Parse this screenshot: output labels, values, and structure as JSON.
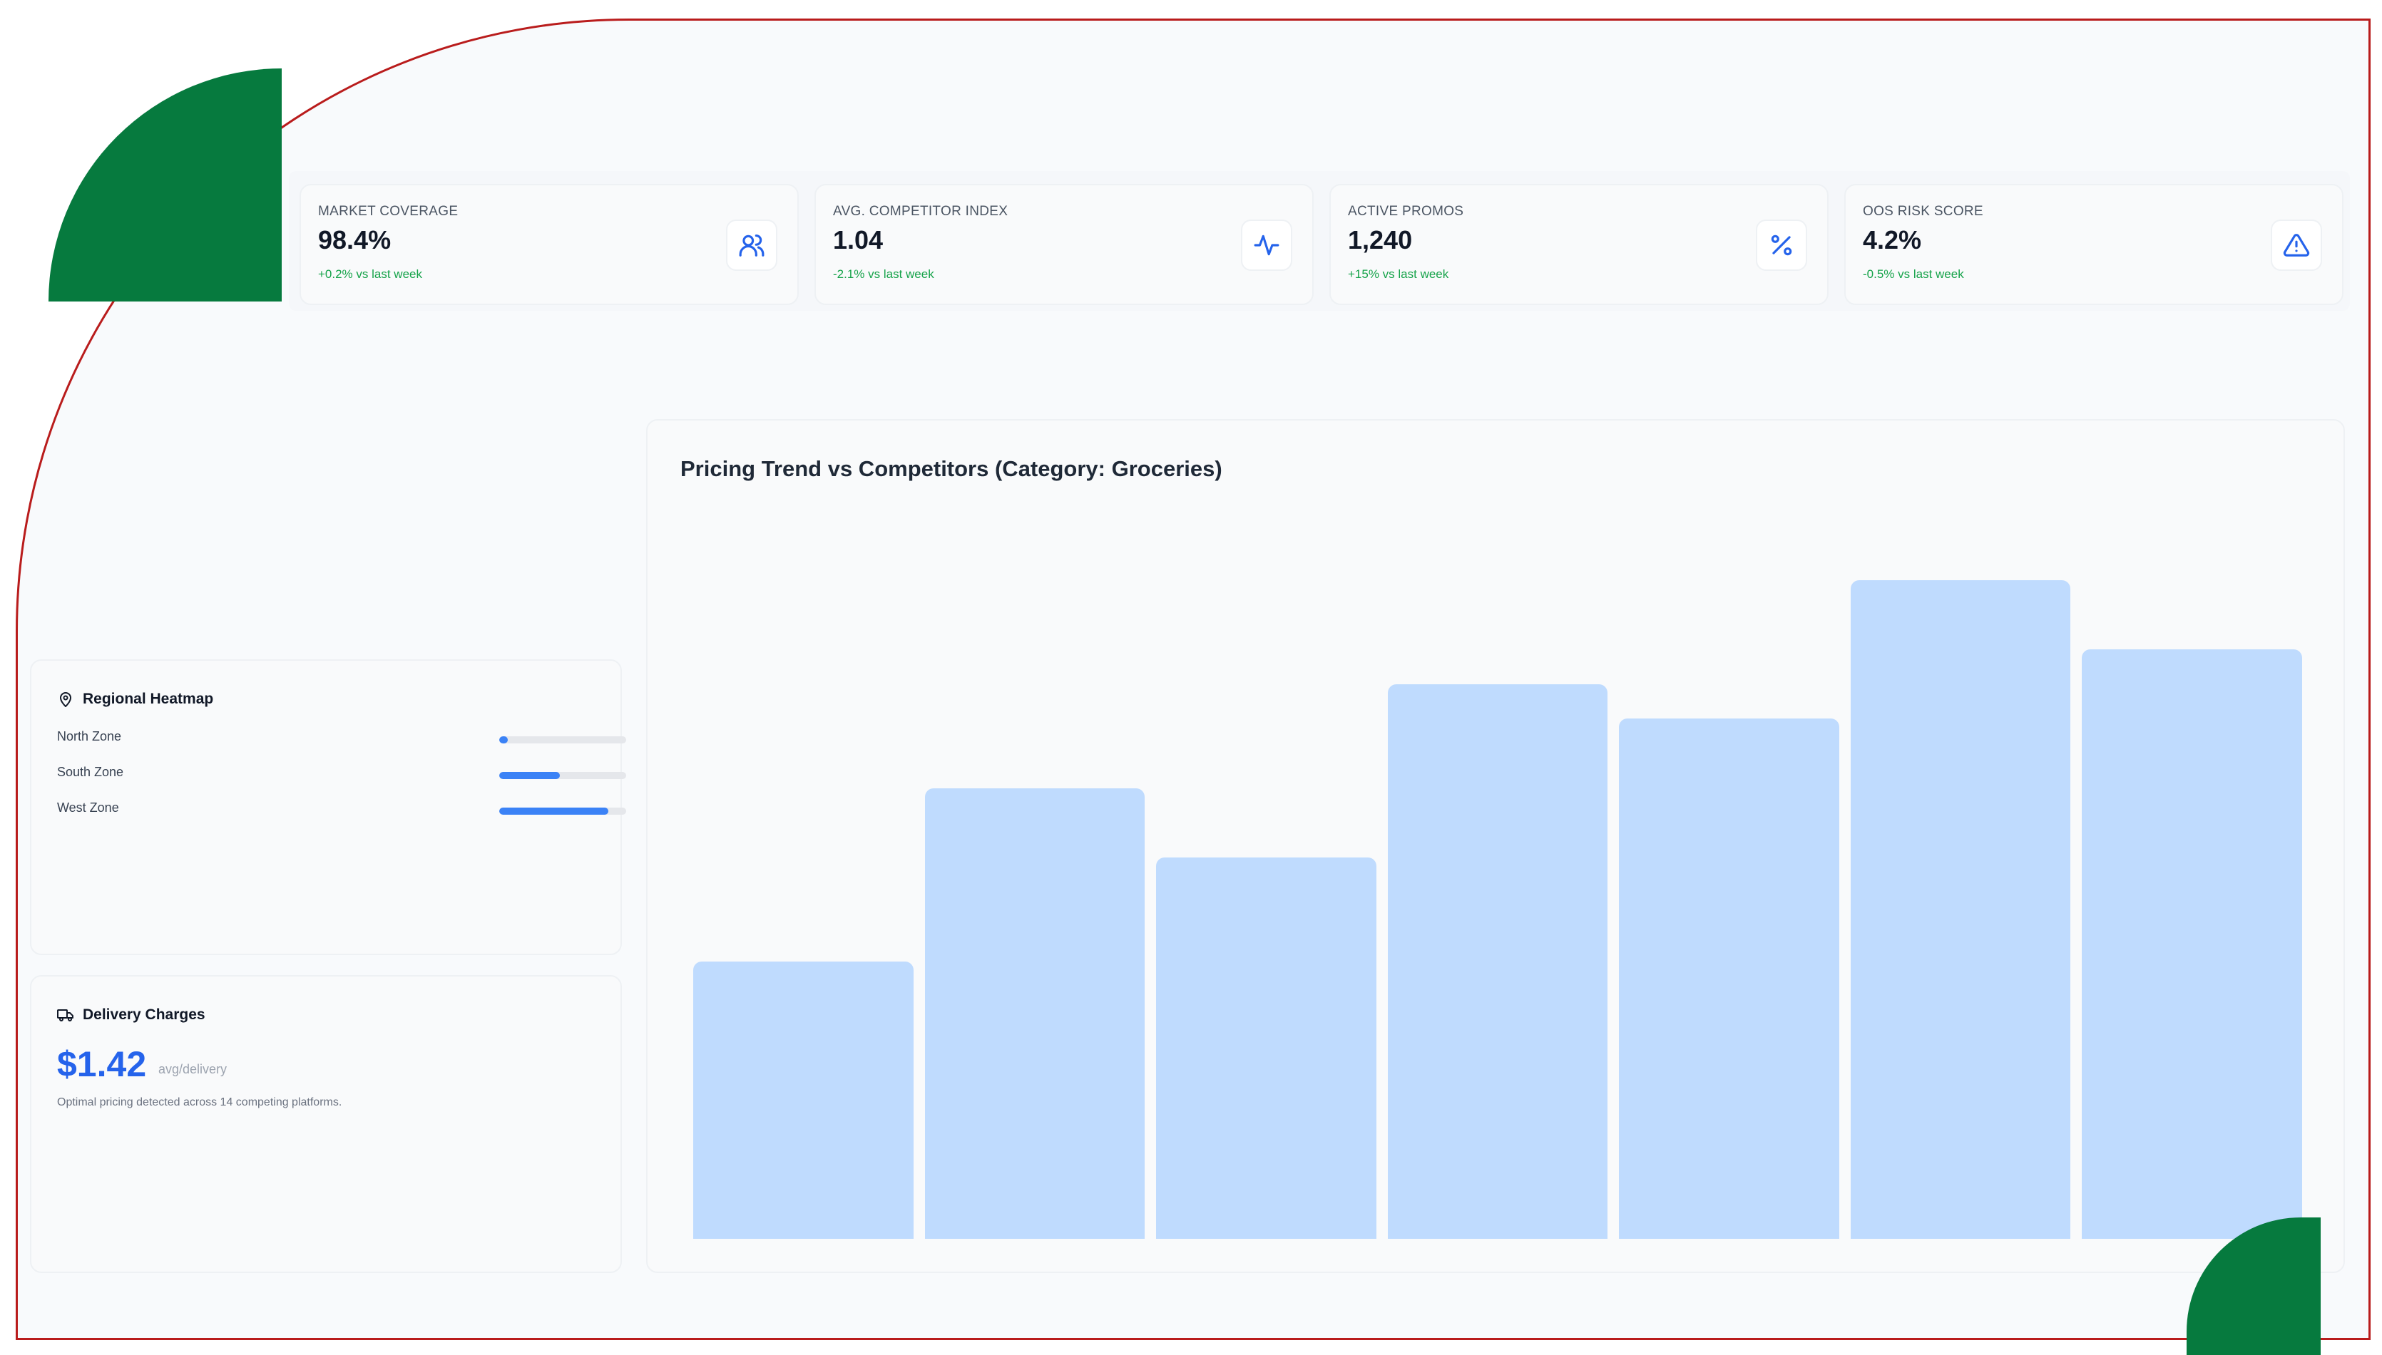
{
  "kpis": [
    {
      "label": "MARKET COVERAGE",
      "value": "98.4%",
      "delta": "+0.2% vs last week",
      "icon": "users-icon"
    },
    {
      "label": "AVG. COMPETITOR INDEX",
      "value": "1.04",
      "delta": "-2.1% vs last week",
      "icon": "activity-icon"
    },
    {
      "label": "ACTIVE PROMOS",
      "value": "1,240",
      "delta": "+15% vs last week",
      "icon": "percent-icon"
    },
    {
      "label": "OOS RISK SCORE",
      "value": "4.2%",
      "delta": "-0.5% vs last week",
      "icon": "alert-triangle-icon"
    }
  ],
  "heatmap": {
    "title": "Regional Heatmap",
    "icon": "map-pin-icon",
    "zones": [
      {
        "name": "North Zone",
        "level": 0.07
      },
      {
        "name": "South Zone",
        "level": 0.48
      },
      {
        "name": "West Zone",
        "level": 0.86
      }
    ]
  },
  "delivery": {
    "title": "Delivery Charges",
    "icon": "truck-icon",
    "value": "$1.42",
    "unit": "avg/delivery",
    "note": "Optimal pricing detected across 14 competing platforms."
  },
  "chart_data": {
    "type": "bar",
    "title": "Pricing Trend vs Competitors (Category: Groceries)",
    "categories": [],
    "values": [
      40,
      65,
      55,
      80,
      75,
      95,
      85
    ],
    "ylim": [
      0,
      100
    ],
    "grid": false,
    "color": "#bfdbfe"
  },
  "colors": {
    "accent": "#2563eb",
    "positive": "#16a34a",
    "brand_green": "#067a3e",
    "frame_red": "#b91c1c"
  }
}
